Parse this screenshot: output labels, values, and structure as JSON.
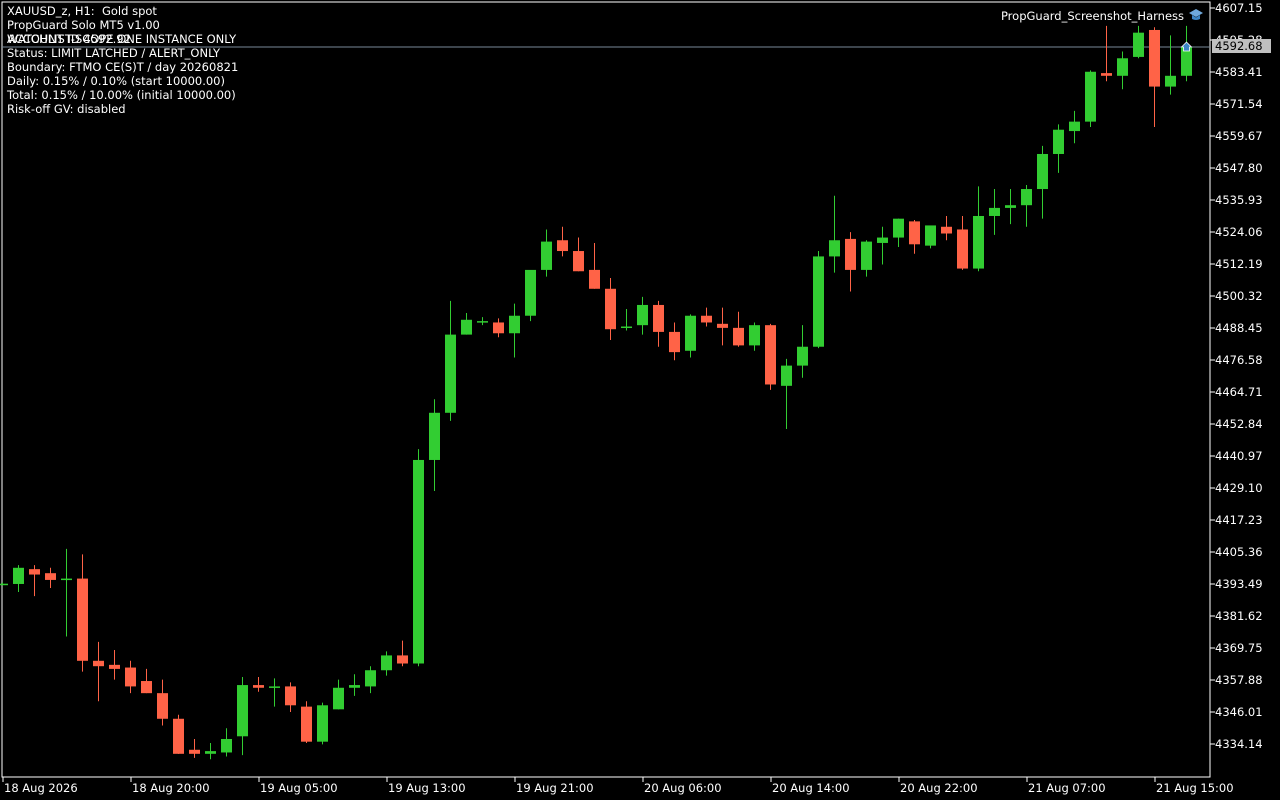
{
  "symbol_line": "XAUUSD_z, H1:  Gold spot",
  "info_lines": [
    "PropGuard Solo MT5 v1.00",
    "ACCOUNT ID 4592.92",
    "WATCHLIST-SCOPE ONE INSTANCE ONLY",
    "Status: LIMIT LATCHED / ALERT_ONLY",
    "Boundary: FTMO CE(S)T / day 20260821",
    "Daily: 0.15% / 0.10% (start 10000.00)",
    "Total: 0.15% / 10.00% (initial 10000.00)",
    "Risk-off GV: disabled"
  ],
  "expert_name": "PropGuard_Screenshot_Harness",
  "current_price": "4592.68",
  "price_axis": {
    "min": 4328.0,
    "max": 4607.15,
    "labels": [
      "4607.15",
      "4595.28",
      "4583.41",
      "4571.54",
      "4559.67",
      "4547.80",
      "4535.93",
      "4524.06",
      "4512.19",
      "4500.32",
      "4488.45",
      "4476.58",
      "4464.71",
      "4452.84",
      "4440.97",
      "4429.10",
      "4417.23",
      "4405.36",
      "4393.49",
      "4381.62",
      "4369.75",
      "4357.88",
      "4346.01",
      "4334.14"
    ]
  },
  "time_axis": {
    "labels": [
      "18 Aug 2026",
      "18 Aug 20:00",
      "19 Aug 05:00",
      "19 Aug 13:00",
      "19 Aug 21:00",
      "20 Aug 06:00",
      "20 Aug 14:00",
      "20 Aug 22:00",
      "21 Aug 07:00",
      "21 Aug 15:00"
    ]
  },
  "colors": {
    "bull": "#32cd32",
    "bear": "#ff6347",
    "wick_bull": "#32cd32",
    "wick_bear": "#ff6347",
    "grid": "#ffffff",
    "bid_line": "#778899"
  },
  "chart_data": {
    "type": "candlestick",
    "ylim": [
      4328.0,
      4607.15
    ],
    "candles": [
      {
        "o": 4393.2,
        "h": 4394.0,
        "l": 4393.0,
        "c": 4393.6
      },
      {
        "o": 4393.5,
        "h": 4400.5,
        "l": 4390.5,
        "c": 4399.5
      },
      {
        "o": 4399.0,
        "h": 4400.5,
        "l": 4389.0,
        "c": 4397.0
      },
      {
        "o": 4397.5,
        "h": 4399.5,
        "l": 4392.0,
        "c": 4395.0
      },
      {
        "o": 4395.0,
        "h": 4406.5,
        "l": 4374.0,
        "c": 4395.5
      },
      {
        "o": 4395.5,
        "h": 4404.5,
        "l": 4361.0,
        "c": 4365.0
      },
      {
        "o": 4365.0,
        "h": 4372.0,
        "l": 4350.0,
        "c": 4363.0
      },
      {
        "o": 4363.5,
        "h": 4369.0,
        "l": 4358.0,
        "c": 4362.0
      },
      {
        "o": 4362.5,
        "h": 4365.0,
        "l": 4353.0,
        "c": 4355.5
      },
      {
        "o": 4357.5,
        "h": 4362.0,
        "l": 4353.0,
        "c": 4353.0
      },
      {
        "o": 4353.0,
        "h": 4358.0,
        "l": 4341.0,
        "c": 4343.5
      },
      {
        "o": 4343.5,
        "h": 4345.0,
        "l": 4330.5,
        "c": 4330.5
      },
      {
        "o": 4332.0,
        "h": 4336.0,
        "l": 4329.0,
        "c": 4330.5
      },
      {
        "o": 4330.5,
        "h": 4334.5,
        "l": 4328.5,
        "c": 4331.5
      },
      {
        "o": 4331.0,
        "h": 4340.0,
        "l": 4329.5,
        "c": 4336.0
      },
      {
        "o": 4337.0,
        "h": 4359.0,
        "l": 4330.0,
        "c": 4356.0
      },
      {
        "o": 4356.0,
        "h": 4359.0,
        "l": 4353.5,
        "c": 4355.0
      },
      {
        "o": 4355.5,
        "h": 4358.5,
        "l": 4348.0,
        "c": 4355.5
      },
      {
        "o": 4355.5,
        "h": 4357.0,
        "l": 4346.0,
        "c": 4348.5
      },
      {
        "o": 4348.0,
        "h": 4350.0,
        "l": 4334.5,
        "c": 4335.0
      },
      {
        "o": 4335.0,
        "h": 4349.5,
        "l": 4334.0,
        "c": 4348.5
      },
      {
        "o": 4347.0,
        "h": 4358.0,
        "l": 4347.0,
        "c": 4355.0
      },
      {
        "o": 4355.0,
        "h": 4360.0,
        "l": 4352.0,
        "c": 4356.0
      },
      {
        "o": 4355.5,
        "h": 4363.0,
        "l": 4353.0,
        "c": 4361.5
      },
      {
        "o": 4361.5,
        "h": 4368.5,
        "l": 4359.5,
        "c": 4367.0
      },
      {
        "o": 4367.0,
        "h": 4372.5,
        "l": 4363.0,
        "c": 4364.0
      },
      {
        "o": 4364.0,
        "h": 4443.5,
        "l": 4363.0,
        "c": 4439.5
      },
      {
        "o": 4439.5,
        "h": 4462.0,
        "l": 4428.0,
        "c": 4457.0
      },
      {
        "o": 4457.0,
        "h": 4498.5,
        "l": 4454.0,
        "c": 4486.0
      },
      {
        "o": 4486.0,
        "h": 4494.0,
        "l": 4486.0,
        "c": 4491.5
      },
      {
        "o": 4491.0,
        "h": 4492.5,
        "l": 4489.5,
        "c": 4491.0
      },
      {
        "o": 4490.5,
        "h": 4492.0,
        "l": 4485.0,
        "c": 4486.5
      },
      {
        "o": 4486.5,
        "h": 4497.5,
        "l": 4477.5,
        "c": 4493.0
      },
      {
        "o": 4493.0,
        "h": 4504.5,
        "l": 4491.0,
        "c": 4510.0
      },
      {
        "o": 4510.0,
        "h": 4525.0,
        "l": 4507.5,
        "c": 4520.5
      },
      {
        "o": 4521.0,
        "h": 4526.0,
        "l": 4515.0,
        "c": 4517.0
      },
      {
        "o": 4517.0,
        "h": 4522.0,
        "l": 4509.5,
        "c": 4509.5
      },
      {
        "o": 4510.0,
        "h": 4520.0,
        "l": 4503.0,
        "c": 4503.0
      },
      {
        "o": 4503.0,
        "h": 4507.0,
        "l": 4484.0,
        "c": 4488.0
      },
      {
        "o": 4488.5,
        "h": 4495.5,
        "l": 4487.5,
        "c": 4489.0
      },
      {
        "o": 4489.5,
        "h": 4500.0,
        "l": 4486.0,
        "c": 4497.0
      },
      {
        "o": 4497.0,
        "h": 4498.5,
        "l": 4481.5,
        "c": 4487.0
      },
      {
        "o": 4487.0,
        "h": 4490.5,
        "l": 4476.5,
        "c": 4479.5
      },
      {
        "o": 4480.0,
        "h": 4493.5,
        "l": 4477.5,
        "c": 4493.0
      },
      {
        "o": 4493.0,
        "h": 4496.0,
        "l": 4489.0,
        "c": 4490.5
      },
      {
        "o": 4490.0,
        "h": 4496.0,
        "l": 4482.0,
        "c": 4488.5
      },
      {
        "o": 4488.5,
        "h": 4494.5,
        "l": 4481.5,
        "c": 4482.0
      },
      {
        "o": 4482.0,
        "h": 4490.5,
        "l": 4480.0,
        "c": 4489.5
      },
      {
        "o": 4489.5,
        "h": 4490.0,
        "l": 4465.5,
        "c": 4467.5
      },
      {
        "o": 4467.0,
        "h": 4477.0,
        "l": 4451.0,
        "c": 4474.5
      },
      {
        "o": 4474.5,
        "h": 4489.5,
        "l": 4470.0,
        "c": 4481.5
      },
      {
        "o": 4481.5,
        "h": 4517.0,
        "l": 4481.0,
        "c": 4515.0
      },
      {
        "o": 4515.0,
        "h": 4537.5,
        "l": 4509.0,
        "c": 4521.0
      },
      {
        "o": 4521.5,
        "h": 4524.0,
        "l": 4502.0,
        "c": 4510.0
      },
      {
        "o": 4510.0,
        "h": 4521.0,
        "l": 4507.5,
        "c": 4520.5
      },
      {
        "o": 4520.0,
        "h": 4526.0,
        "l": 4512.0,
        "c": 4522.0
      },
      {
        "o": 4522.0,
        "h": 4529.0,
        "l": 4518.5,
        "c": 4529.0
      },
      {
        "o": 4528.0,
        "h": 4528.5,
        "l": 4516.0,
        "c": 4519.5
      },
      {
        "o": 4519.0,
        "h": 4526.0,
        "l": 4518.0,
        "c": 4526.5
      },
      {
        "o": 4526.0,
        "h": 4530.0,
        "l": 4521.0,
        "c": 4523.5
      },
      {
        "o": 4525.0,
        "h": 4530.0,
        "l": 4510.0,
        "c": 4510.5
      },
      {
        "o": 4510.5,
        "h": 4541.0,
        "l": 4509.5,
        "c": 4530.0
      },
      {
        "o": 4530.0,
        "h": 4540.0,
        "l": 4523.0,
        "c": 4533.0
      },
      {
        "o": 4533.0,
        "h": 4540.0,
        "l": 4527.0,
        "c": 4534.0
      },
      {
        "o": 4534.0,
        "h": 4541.5,
        "l": 4526.0,
        "c": 4540.0
      },
      {
        "o": 4540.0,
        "h": 4556.0,
        "l": 4529.0,
        "c": 4553.0
      },
      {
        "o": 4553.0,
        "h": 4564.0,
        "l": 4546.0,
        "c": 4562.0
      },
      {
        "o": 4561.5,
        "h": 4569.0,
        "l": 4557.0,
        "c": 4565.0
      },
      {
        "o": 4565.0,
        "h": 4584.0,
        "l": 4563.0,
        "c": 4583.5
      },
      {
        "o": 4583.0,
        "h": 4600.5,
        "l": 4580.0,
        "c": 4582.0
      },
      {
        "o": 4582.0,
        "h": 4591.0,
        "l": 4577.0,
        "c": 4588.5
      },
      {
        "o": 4589.0,
        "h": 4600.5,
        "l": 4588.5,
        "c": 4598.0
      },
      {
        "o": 4599.0,
        "h": 4600.0,
        "l": 4563.0,
        "c": 4578.0
      },
      {
        "o": 4578.0,
        "h": 4597.0,
        "l": 4575.0,
        "c": 4582.0
      },
      {
        "o": 4582.0,
        "h": 4600.5,
        "l": 4580.0,
        "c": 4592.7
      }
    ]
  }
}
